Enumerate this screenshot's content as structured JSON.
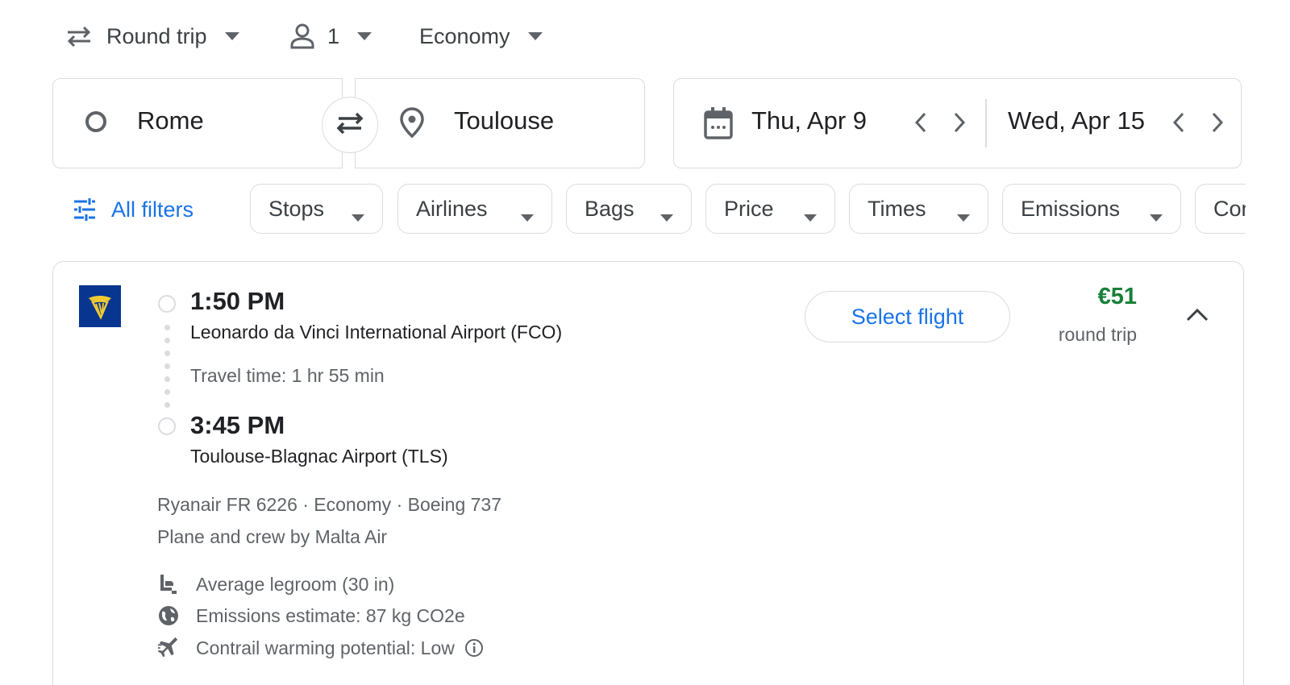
{
  "trip_options": {
    "trip_type": "Round trip",
    "passengers": "1",
    "cabin_class": "Economy"
  },
  "search": {
    "origin": "Rome",
    "destination": "Toulouse",
    "depart_date": "Thu, Apr 9",
    "return_date": "Wed, Apr 15"
  },
  "filters": {
    "all_filters_label": "All filters",
    "chips": [
      "Stops",
      "Airlines",
      "Bags",
      "Price",
      "Times",
      "Emissions",
      "Connecting airports"
    ]
  },
  "result": {
    "departure": {
      "time": "1:50 PM",
      "airport": "Leonardo da Vinci International Airport (FCO)"
    },
    "travel_time": "Travel time: 1 hr 55 min",
    "arrival": {
      "time": "3:45 PM",
      "airport": "Toulouse-Blagnac Airport (TLS)"
    },
    "flight_info": "Ryanair FR 6226 · Economy · Boeing 737",
    "operator": "Plane and crew by Malta Air",
    "amenities": {
      "legroom": "Average legroom (30 in)",
      "emissions": "Emissions estimate: 87 kg CO2e",
      "contrail": "Contrail warming potential: Low"
    },
    "select_label": "Select flight",
    "price": "€51",
    "price_note": "round trip"
  },
  "colors": {
    "accent": "#1a73e8",
    "price": "#188038",
    "airline_logo": "#073590"
  }
}
